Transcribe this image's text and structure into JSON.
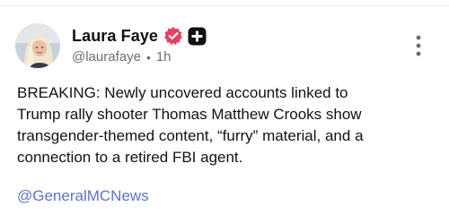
{
  "post": {
    "author": {
      "display_name": "Laura Faye",
      "handle": "@laurafaye",
      "verified_icon": "verified-badge-icon",
      "plus_icon": "plus-badge-icon"
    },
    "time": "1h",
    "meta_separator": "•",
    "body": "BREAKING: Newly uncovered accounts linked to\nTrump rally shooter Thomas Matthew Crooks show\ntransgender-themed content, “furry” material, and a\nconnection to a retired FBI agent.",
    "mention": "@GeneralMCNews",
    "more_icon": "more-vertical-icon"
  },
  "colors": {
    "verified": "#e8405f",
    "plus_badge": "#111111",
    "link": "#5b75c8",
    "meta_text": "#6e6e73"
  }
}
